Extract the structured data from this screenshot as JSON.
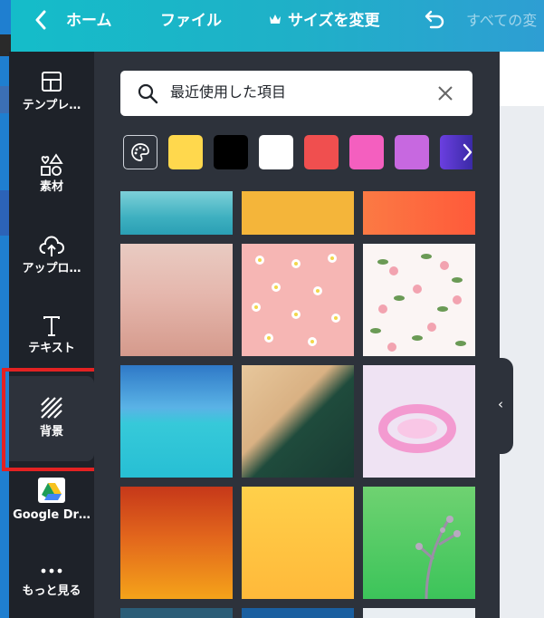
{
  "header": {
    "back_icon": "chevron-left-icon",
    "home_label": "ホーム",
    "file_label": "ファイル",
    "resize_label": "サイズを変更",
    "crown_icon": "crown-icon",
    "undo_icon": "undo-icon",
    "right_text": "すべての変"
  },
  "sidebar": {
    "items": [
      {
        "label": "テンプレ…",
        "icon": "template-icon"
      },
      {
        "label": "素材",
        "icon": "elements-icon"
      },
      {
        "label": "アップロ…",
        "icon": "upload-icon"
      },
      {
        "label": "テキスト",
        "icon": "text-icon"
      },
      {
        "label": "背景",
        "icon": "background-icon",
        "active": true
      },
      {
        "label": "Google Dr…",
        "icon": "google-drive-icon"
      },
      {
        "label": "もっと見る",
        "icon": "more-icon"
      }
    ]
  },
  "panel": {
    "search_placeholder": "最近使用した項目",
    "search_icon": "search-icon",
    "clear_icon": "close-icon",
    "palette_icon": "palette-icon",
    "swatches": [
      "#ffd84d",
      "#000000",
      "#ffffff",
      "#f04f4f",
      "#f45fbf",
      "#c768e0",
      "#6b3fe0"
    ],
    "next_icon": "chevron-right-icon",
    "collapse_icon": "chevron-left-icon"
  },
  "colors": {
    "header_gradient_start": "#14bdc9",
    "header_gradient_end": "#2e9ed3",
    "sidebar_bg": "#1e2229",
    "panel_bg": "#2d323b",
    "highlight": "#e32222"
  }
}
